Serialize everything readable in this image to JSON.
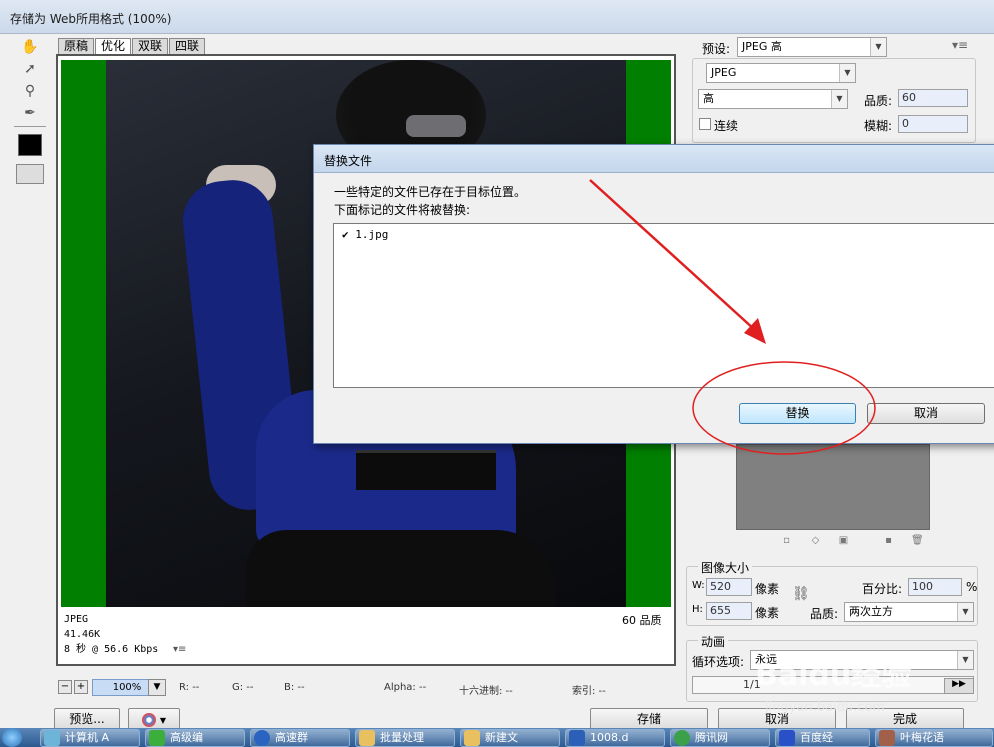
{
  "window": {
    "title": "存储为 Web所用格式 (100%)"
  },
  "view_tabs": [
    "原稿",
    "优化",
    "双联",
    "四联"
  ],
  "image_info": {
    "format": "JPEG",
    "size": "41.46K",
    "speed": "8 秒 @ 56.6 Kbps",
    "quality": "60 品质"
  },
  "status_bar": {
    "zoom": "100%",
    "r": "R: --",
    "g": "G: --",
    "b": "B: --",
    "alpha": "Alpha: --",
    "hex": "十六进制: --",
    "index": "索引: --"
  },
  "bottom_buttons": {
    "preview": "预览...",
    "save": "存储",
    "cancel": "取消",
    "done": "完成"
  },
  "settings": {
    "preset_label": "预设:",
    "preset_value": "JPEG 高",
    "format_value": "JPEG",
    "quality_level": "高",
    "quality_label": "品质:",
    "quality_value": "60",
    "progressive_label": "连续",
    "blur_label": "模糊:",
    "blur_value": "0"
  },
  "image_size": {
    "title": "图像大小",
    "w_label": "W:",
    "w_value": "520",
    "w_unit": "像素",
    "h_label": "H:",
    "h_value": "655",
    "h_unit": "像素",
    "percent_label": "百分比:",
    "percent_value": "100",
    "percent_unit": "%",
    "quality_label": "品质:",
    "quality_value": "两次立方"
  },
  "animation": {
    "title": "动画",
    "loop_label": "循环选项:",
    "loop_value": "永远",
    "frame": "1/1"
  },
  "dialog": {
    "title": "替换文件",
    "message1": "一些特定的文件已存在于目标位置。",
    "message2": "下面标记的文件将被替换:",
    "files": [
      "1.jpg"
    ],
    "replace_button": "替换",
    "cancel_button": "取消"
  },
  "taskbar": {
    "items": [
      "计算机 A",
      "高级编",
      "高速群",
      "批量处理",
      "新建文",
      "1008.d",
      "腾讯网",
      "百度经",
      "叶梅花语"
    ]
  },
  "watermark": {
    "logo": "Baidu经验",
    "url": "jingyan.baidu.com"
  },
  "colors": {
    "matte_green": "#007f00",
    "annotation_red": "#e02020",
    "dialog_border": "#6a87b3"
  }
}
